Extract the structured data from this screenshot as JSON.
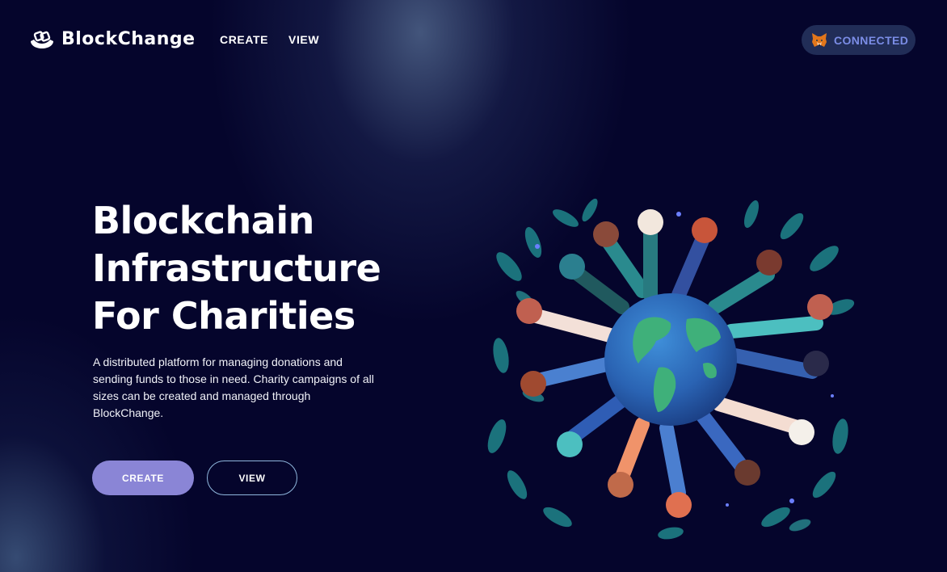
{
  "brand": {
    "name": "BlockChange",
    "logo_icon": "blockchain-hand-icon"
  },
  "nav": {
    "links": [
      {
        "label": "CREATE"
      },
      {
        "label": "VIEW"
      }
    ]
  },
  "wallet": {
    "label": "CONNECTED",
    "icon": "metamask-fox-icon",
    "color": "#7b8de6",
    "background": "#212d57"
  },
  "hero": {
    "title_lines": [
      "Blockchain",
      "Infrastructure",
      "For Charities"
    ],
    "description": "A distributed platform for managing donations and sending funds to those in need. Charity campaigns of all sizes can be created and managed through BlockChange.",
    "buttons": {
      "create": {
        "label": "CREATE",
        "color": "#8a85d6"
      },
      "view": {
        "label": "VIEW",
        "border_color": "#8fb6dc"
      }
    }
  },
  "illustration": {
    "icon": "people-around-globe-illustration"
  },
  "theme": {
    "background": "#05052c",
    "glow": "#46628a",
    "text": "#ffffff"
  }
}
